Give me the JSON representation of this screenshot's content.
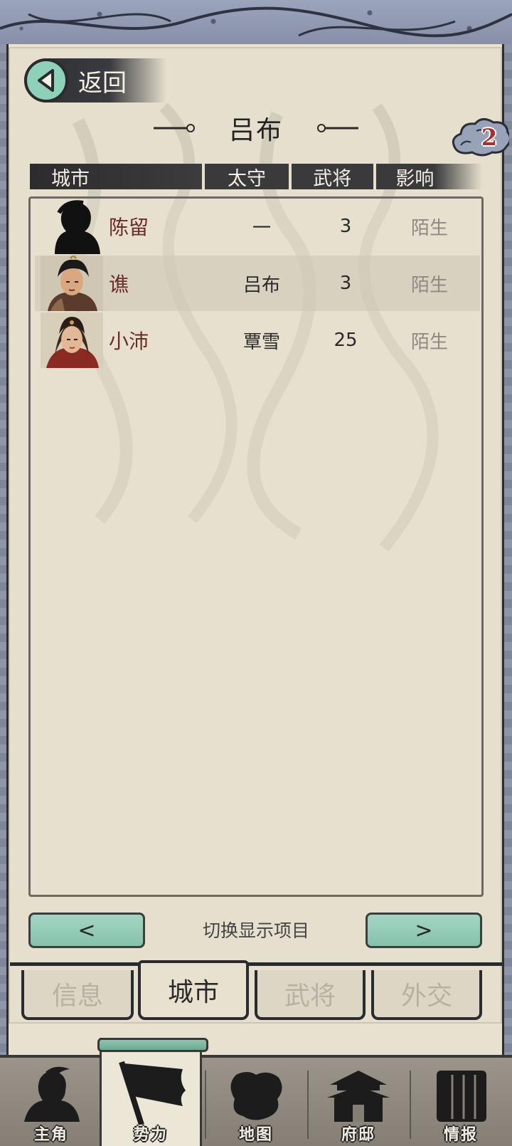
{
  "header": {
    "back_label": "返回",
    "faction_name": "吕布",
    "badge_count": "2"
  },
  "table": {
    "columns": [
      "城市",
      "太守",
      "武将",
      "影响"
    ],
    "rows": [
      {
        "city": "陈留",
        "governor": "一",
        "generals": "3",
        "influence": "陌生",
        "avatar": "silhouette-portrait"
      },
      {
        "city": "谯",
        "governor": "吕布",
        "generals": "3",
        "influence": "陌生",
        "avatar": "warrior-portrait"
      },
      {
        "city": "小沛",
        "governor": "覃雪",
        "generals": "25",
        "influence": "陌生",
        "avatar": "woman-portrait"
      }
    ]
  },
  "switcher": {
    "prev_label": "<",
    "label": "切换显示项目",
    "next_label": ">"
  },
  "subtabs": [
    {
      "label": "信息",
      "active": false
    },
    {
      "label": "城市",
      "active": true
    },
    {
      "label": "武将",
      "active": false
    },
    {
      "label": "外交",
      "active": false
    }
  ],
  "bottom_nav": [
    {
      "label": "主角",
      "icon": "hero-icon",
      "active": false
    },
    {
      "label": "势力",
      "icon": "flag-icon",
      "active": true
    },
    {
      "label": "地图",
      "icon": "map-icon",
      "active": false
    },
    {
      "label": "府邸",
      "icon": "mansion-icon",
      "active": false
    },
    {
      "label": "情报",
      "icon": "scroll-icon",
      "active": false
    }
  ],
  "colors": {
    "accent_green": "#8fd0b8",
    "city_text": "#6a2c24",
    "badge_red": "#a8322e"
  }
}
